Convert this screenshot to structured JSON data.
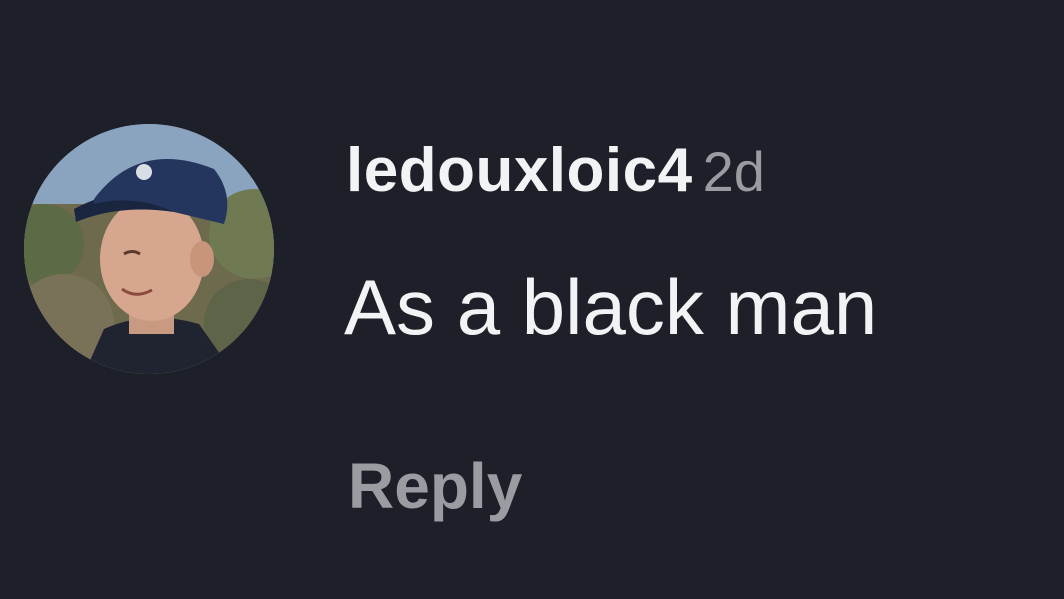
{
  "comment": {
    "avatar_icon": "profile-photo-avatar",
    "username": "ledouxloic4",
    "timestamp": "2d",
    "text": "As a black man",
    "reply_label": "Reply"
  },
  "colors": {
    "background": "#1d2029",
    "primary_text": "#f2f3f5",
    "secondary_text": "#9a9ca2"
  }
}
